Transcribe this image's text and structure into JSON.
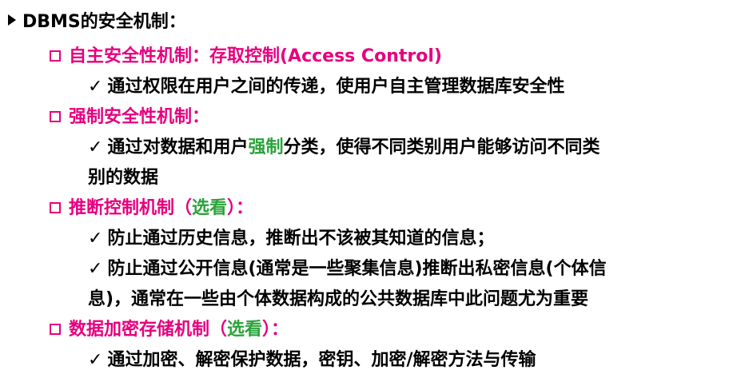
{
  "title": "DBMS的安全机制：",
  "sections": [
    {
      "heading": "自主安全性机制：存取控制(Access Control)",
      "points": [
        {
          "check": "✓",
          "text": "通过权限在用户之间的传递，使用户自主管理数据库安全性"
        }
      ]
    },
    {
      "heading": "强制安全性机制：",
      "points": [
        {
          "check": "✓",
          "text_before": "通过对数据和用户",
          "highlight": "强制",
          "text_after": "分类，使得不同类别用户能够访问不同类",
          "continuation": "别的数据"
        }
      ]
    },
    {
      "heading_main": "推断控制机制（",
      "heading_note": "选看",
      "heading_end": "）：",
      "points": [
        {
          "check": "✓",
          "text": "防止通过历史信息，推断出不该被其知道的信息；"
        },
        {
          "check": "✓",
          "text": "防止通过公开信息(通常是一些聚集信息)推断出私密信息(个体信",
          "continuation": "息)，通常在一些由个体数据构成的公共数据库中此问题尤为重要"
        }
      ]
    },
    {
      "heading_main": "数据加密存储机制（",
      "heading_note": "选看",
      "heading_end": "）：",
      "points": [
        {
          "check": "✓",
          "text": "通过加密、解密保护数据，密钥、加密/解密方法与传输"
        }
      ]
    }
  ],
  "colors": {
    "heading": "#e6007e",
    "highlight": "#2aa33a",
    "text": "#000000"
  }
}
